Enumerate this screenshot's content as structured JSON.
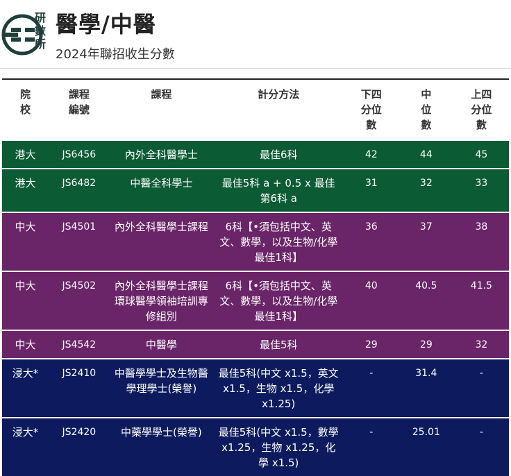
{
  "header": {
    "logo_text": [
      "研",
      "數",
      "所"
    ],
    "title": "醫學/中醫",
    "subtitle": "2024年聯招收生分數"
  },
  "table": {
    "headers": [
      "院\n校",
      "課程\n編號",
      "課程",
      "計分方法",
      "下四\n分位\n數",
      "中\n位\n數",
      "上四\n分位\n數"
    ],
    "rows": [
      {
        "group": "hku",
        "institution": "港大",
        "code": "JS6456",
        "programme": "內外全科醫學士",
        "method": "最佳6科",
        "lq": "42",
        "median": "44",
        "uq": "45"
      },
      {
        "group": "hku",
        "institution": "港大",
        "code": "JS6482",
        "programme": "中醫全科學士",
        "method": "最佳5科 a + 0.5 x 最佳第6科 a",
        "lq": "31",
        "median": "32",
        "uq": "33"
      },
      {
        "group": "cuhk",
        "institution": "中大",
        "code": "JS4501",
        "programme": "內外全科醫學士課程",
        "method": "6科【•須包括中文、英文、數學，以及生物/化學最佳1科】",
        "lq": "36",
        "median": "37",
        "uq": "38"
      },
      {
        "group": "cuhk",
        "institution": "中大",
        "code": "JS4502",
        "programme": "內外全科醫學士課程環球醫學領袖培訓專修組別",
        "method": "6科【•須包括中文、英文、數學，以及生物/化學最佳1科】",
        "lq": "40",
        "median": "40.5",
        "uq": "41.5"
      },
      {
        "group": "cuhk",
        "institution": "中大",
        "code": "JS4542",
        "programme": "中醫學",
        "method": "最佳5科",
        "lq": "29",
        "median": "29",
        "uq": "32"
      },
      {
        "group": "hkbu",
        "institution": "浸大*",
        "code": "JS2410",
        "programme": "中醫學學士及生物醫學理學士(榮譽)",
        "method": "最佳5科(中文 x1.5，英文 x1.5，生物 x1.5，化學 x1.25)",
        "lq": "-",
        "median": "31.4",
        "uq": "-"
      },
      {
        "group": "hkbu",
        "institution": "浸大*",
        "code": "JS2420",
        "programme": "中藥學學士(榮譽)",
        "method": "最佳5科(中文 x1.5，數學 x1.25，生物 x1.25，化學 x1.5)",
        "lq": "-",
        "median": "25.01",
        "uq": "-"
      }
    ]
  },
  "colors": {
    "hku": "#0b5b34",
    "cuhk": "#6a2468",
    "hkbu": "#0d1b5e"
  }
}
